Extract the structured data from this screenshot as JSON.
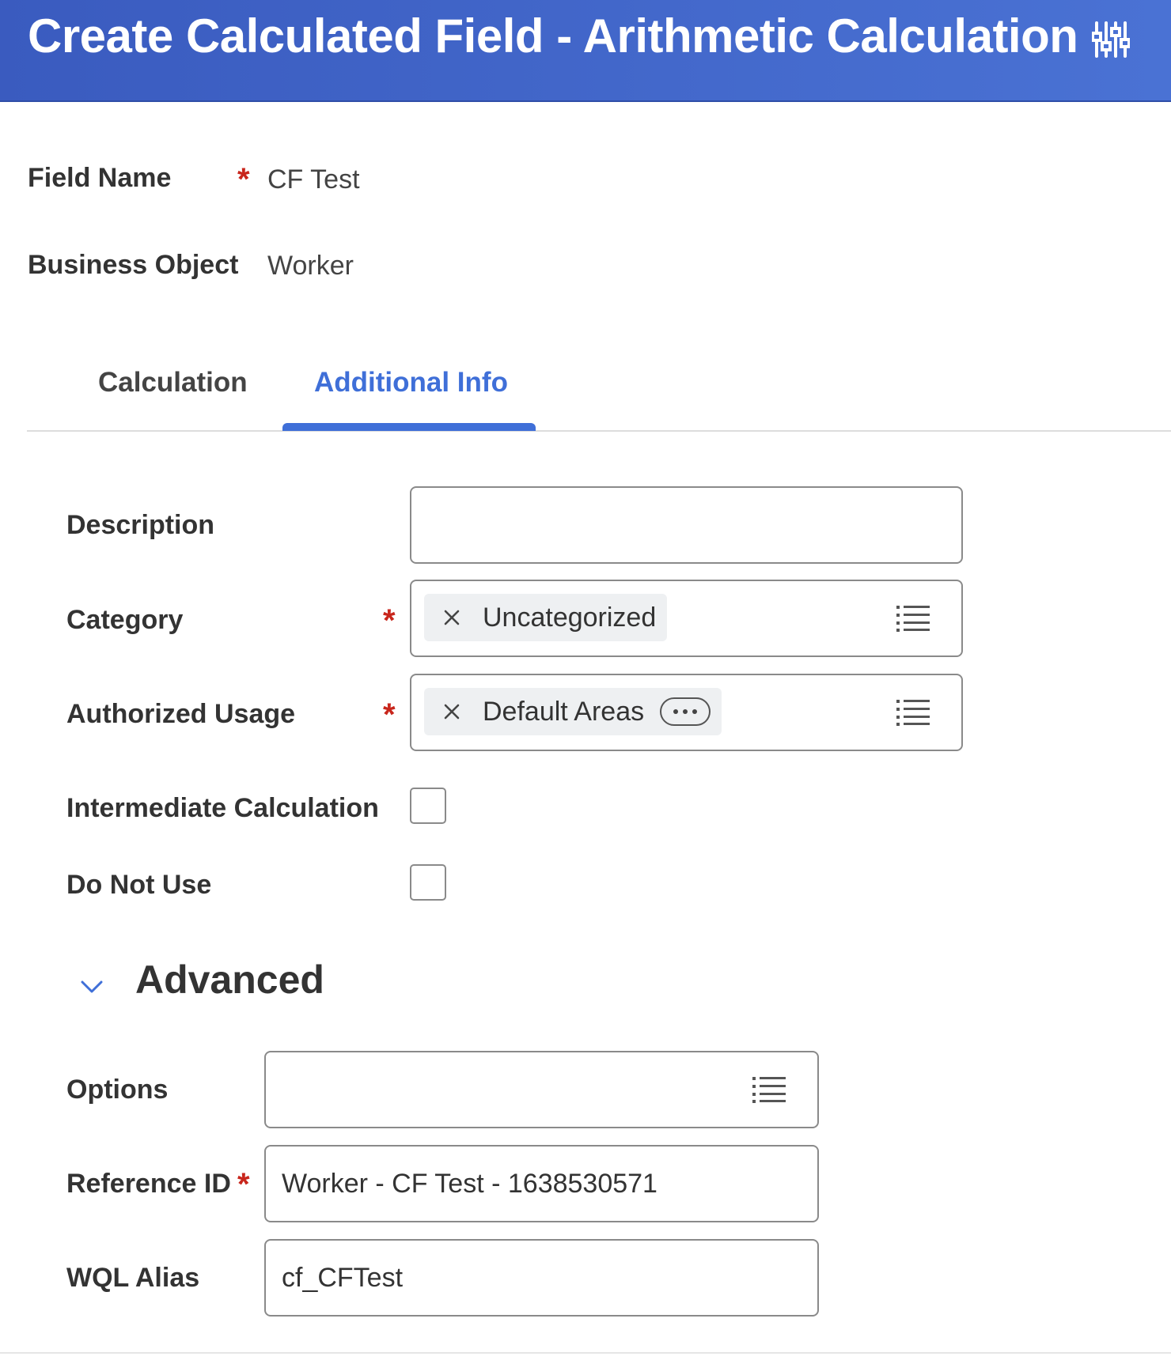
{
  "header": {
    "title": "Create Calculated Field - Arithmetic Calculation",
    "icon": "related-actions-sliders-icon"
  },
  "summary": {
    "field_name_label": "Field Name",
    "field_name_required": "*",
    "field_name_value": "CF Test",
    "business_object_label": "Business Object",
    "business_object_value": "Worker"
  },
  "tabs": [
    {
      "label": "Calculation",
      "active": false
    },
    {
      "label": "Additional Info",
      "active": true
    }
  ],
  "form": {
    "description": {
      "label": "Description",
      "value": ""
    },
    "category": {
      "label": "Category",
      "required": "*",
      "selected": "Uncategorized"
    },
    "authorized_usage": {
      "label": "Authorized Usage",
      "required": "*",
      "selected": "Default Areas"
    },
    "intermediate_calculation": {
      "label": "Intermediate Calculation",
      "checked": false
    },
    "do_not_use": {
      "label": "Do Not Use",
      "checked": false
    }
  },
  "advanced": {
    "title": "Advanced",
    "expanded": true,
    "options": {
      "label": "Options",
      "value": ""
    },
    "reference_id": {
      "label": "Reference ID",
      "required": "*",
      "value": "Worker - CF Test - 1638530571"
    },
    "wql_alias": {
      "label": "WQL Alias",
      "value": "cf_CFTest"
    }
  },
  "colors": {
    "header": "#3f66cc",
    "accent": "#3f6fd8",
    "required": "#c8261c",
    "pill_bg": "#eef0f2"
  }
}
